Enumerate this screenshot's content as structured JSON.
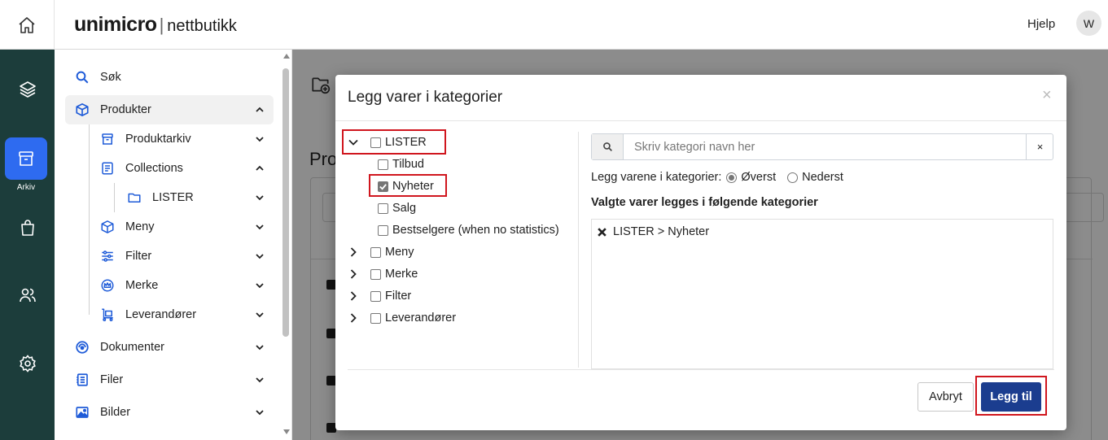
{
  "app": {
    "logo_main": "unimicro",
    "logo_sub": "nettbutikk",
    "help": "Hjelp",
    "avatar_initial": "W"
  },
  "rail": {
    "active_label": "Arkiv"
  },
  "sidebar": {
    "items": [
      {
        "label": "Søk"
      },
      {
        "label": "Produkter"
      },
      {
        "label": "Produktarkiv"
      },
      {
        "label": "Collections"
      },
      {
        "label": "LISTER"
      },
      {
        "label": "Meny"
      },
      {
        "label": "Filter"
      },
      {
        "label": "Merke"
      },
      {
        "label": "Leverandører"
      },
      {
        "label": "Dokumenter"
      },
      {
        "label": "Filer"
      },
      {
        "label": "Bilder"
      }
    ]
  },
  "background": {
    "page_title_fragment": "Pro"
  },
  "modal": {
    "title": "Legg varer i kategorier",
    "close": "×",
    "tree": [
      {
        "label": "LISTER",
        "checked": false,
        "expanded": true
      },
      {
        "label": "Tilbud",
        "checked": false
      },
      {
        "label": "Nyheter",
        "checked": true
      },
      {
        "label": "Salg",
        "checked": false
      },
      {
        "label": "Bestselgere (when no statistics)",
        "checked": false
      },
      {
        "label": "Meny",
        "checked": false
      },
      {
        "label": "Merke",
        "checked": false
      },
      {
        "label": "Filter",
        "checked": false
      },
      {
        "label": "Leverandører",
        "checked": false
      }
    ],
    "search": {
      "placeholder": "Skriv kategori navn her",
      "value": "",
      "clear": "×"
    },
    "placement": {
      "label": "Legg varene i kategorier:",
      "options": [
        "Øverst",
        "Nederst"
      ],
      "selected": "Øverst"
    },
    "selected_heading": "Valgte varer legges i følgende kategorier",
    "selected_items": [
      {
        "path": "LISTER > Nyheter"
      }
    ],
    "buttons": {
      "cancel": "Avbryt",
      "submit": "Legg til"
    }
  },
  "colors": {
    "rail_bg": "#1c3d3b",
    "rail_active": "#2e6bf0",
    "primary_button": "#1b3d8f",
    "highlight": "#d0161e"
  }
}
